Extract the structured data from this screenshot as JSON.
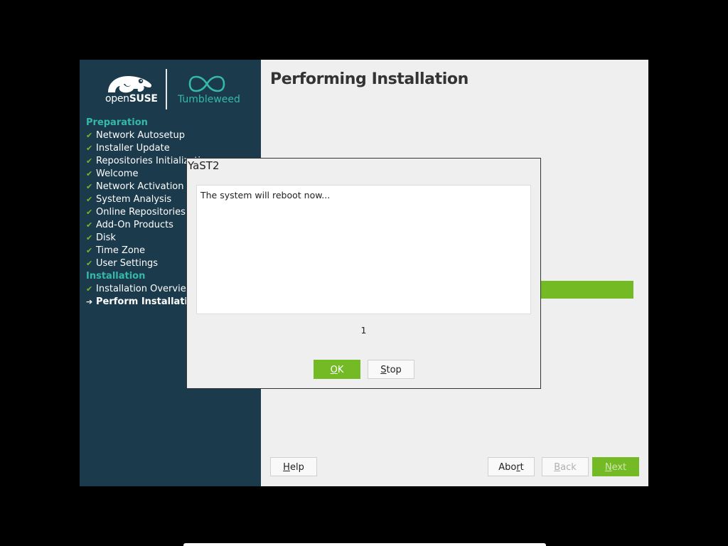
{
  "branding": {
    "opensuse_prefix": "open",
    "opensuse_bold": "SUSE",
    "tumbleweed": "Tumbleweed"
  },
  "sidebar": {
    "sections": [
      {
        "title": "Preparation",
        "steps": [
          {
            "label": "Network Autosetup",
            "status": "done"
          },
          {
            "label": "Installer Update",
            "status": "done"
          },
          {
            "label": "Repositories Initialization",
            "status": "done"
          },
          {
            "label": "Welcome",
            "status": "done"
          },
          {
            "label": "Network Activation",
            "status": "done"
          },
          {
            "label": "System Analysis",
            "status": "done"
          },
          {
            "label": "Online Repositories",
            "status": "done"
          },
          {
            "label": "Add-On Products",
            "status": "done"
          },
          {
            "label": "Disk",
            "status": "done"
          },
          {
            "label": "Time Zone",
            "status": "done"
          },
          {
            "label": "User Settings",
            "status": "done"
          }
        ]
      },
      {
        "title": "Installation",
        "steps": [
          {
            "label": "Installation Overview",
            "status": "done"
          },
          {
            "label": "Perform Installation",
            "status": "current"
          }
        ]
      }
    ]
  },
  "main": {
    "title": "Performing Installation",
    "progress_percent": 100
  },
  "buttons": {
    "help": {
      "mnemonic": "H",
      "rest": "elp"
    },
    "abort": {
      "before": "Abo",
      "mnemonic": "r",
      "after": "t"
    },
    "back": {
      "mnemonic": "B",
      "rest": "ack"
    },
    "next": {
      "mnemonic": "N",
      "rest": "ext"
    }
  },
  "popup": {
    "title": "YaST2",
    "message": "The system will reboot now...",
    "countdown": "1",
    "ok": {
      "mnemonic": "O",
      "rest": "K"
    },
    "stop": {
      "mnemonic": "S",
      "rest": "top"
    }
  },
  "colors": {
    "sidebar_bg": "#1b3a4b",
    "accent_teal": "#35b9ab",
    "accent_green": "#73ba25",
    "content_bg": "#efefef"
  }
}
